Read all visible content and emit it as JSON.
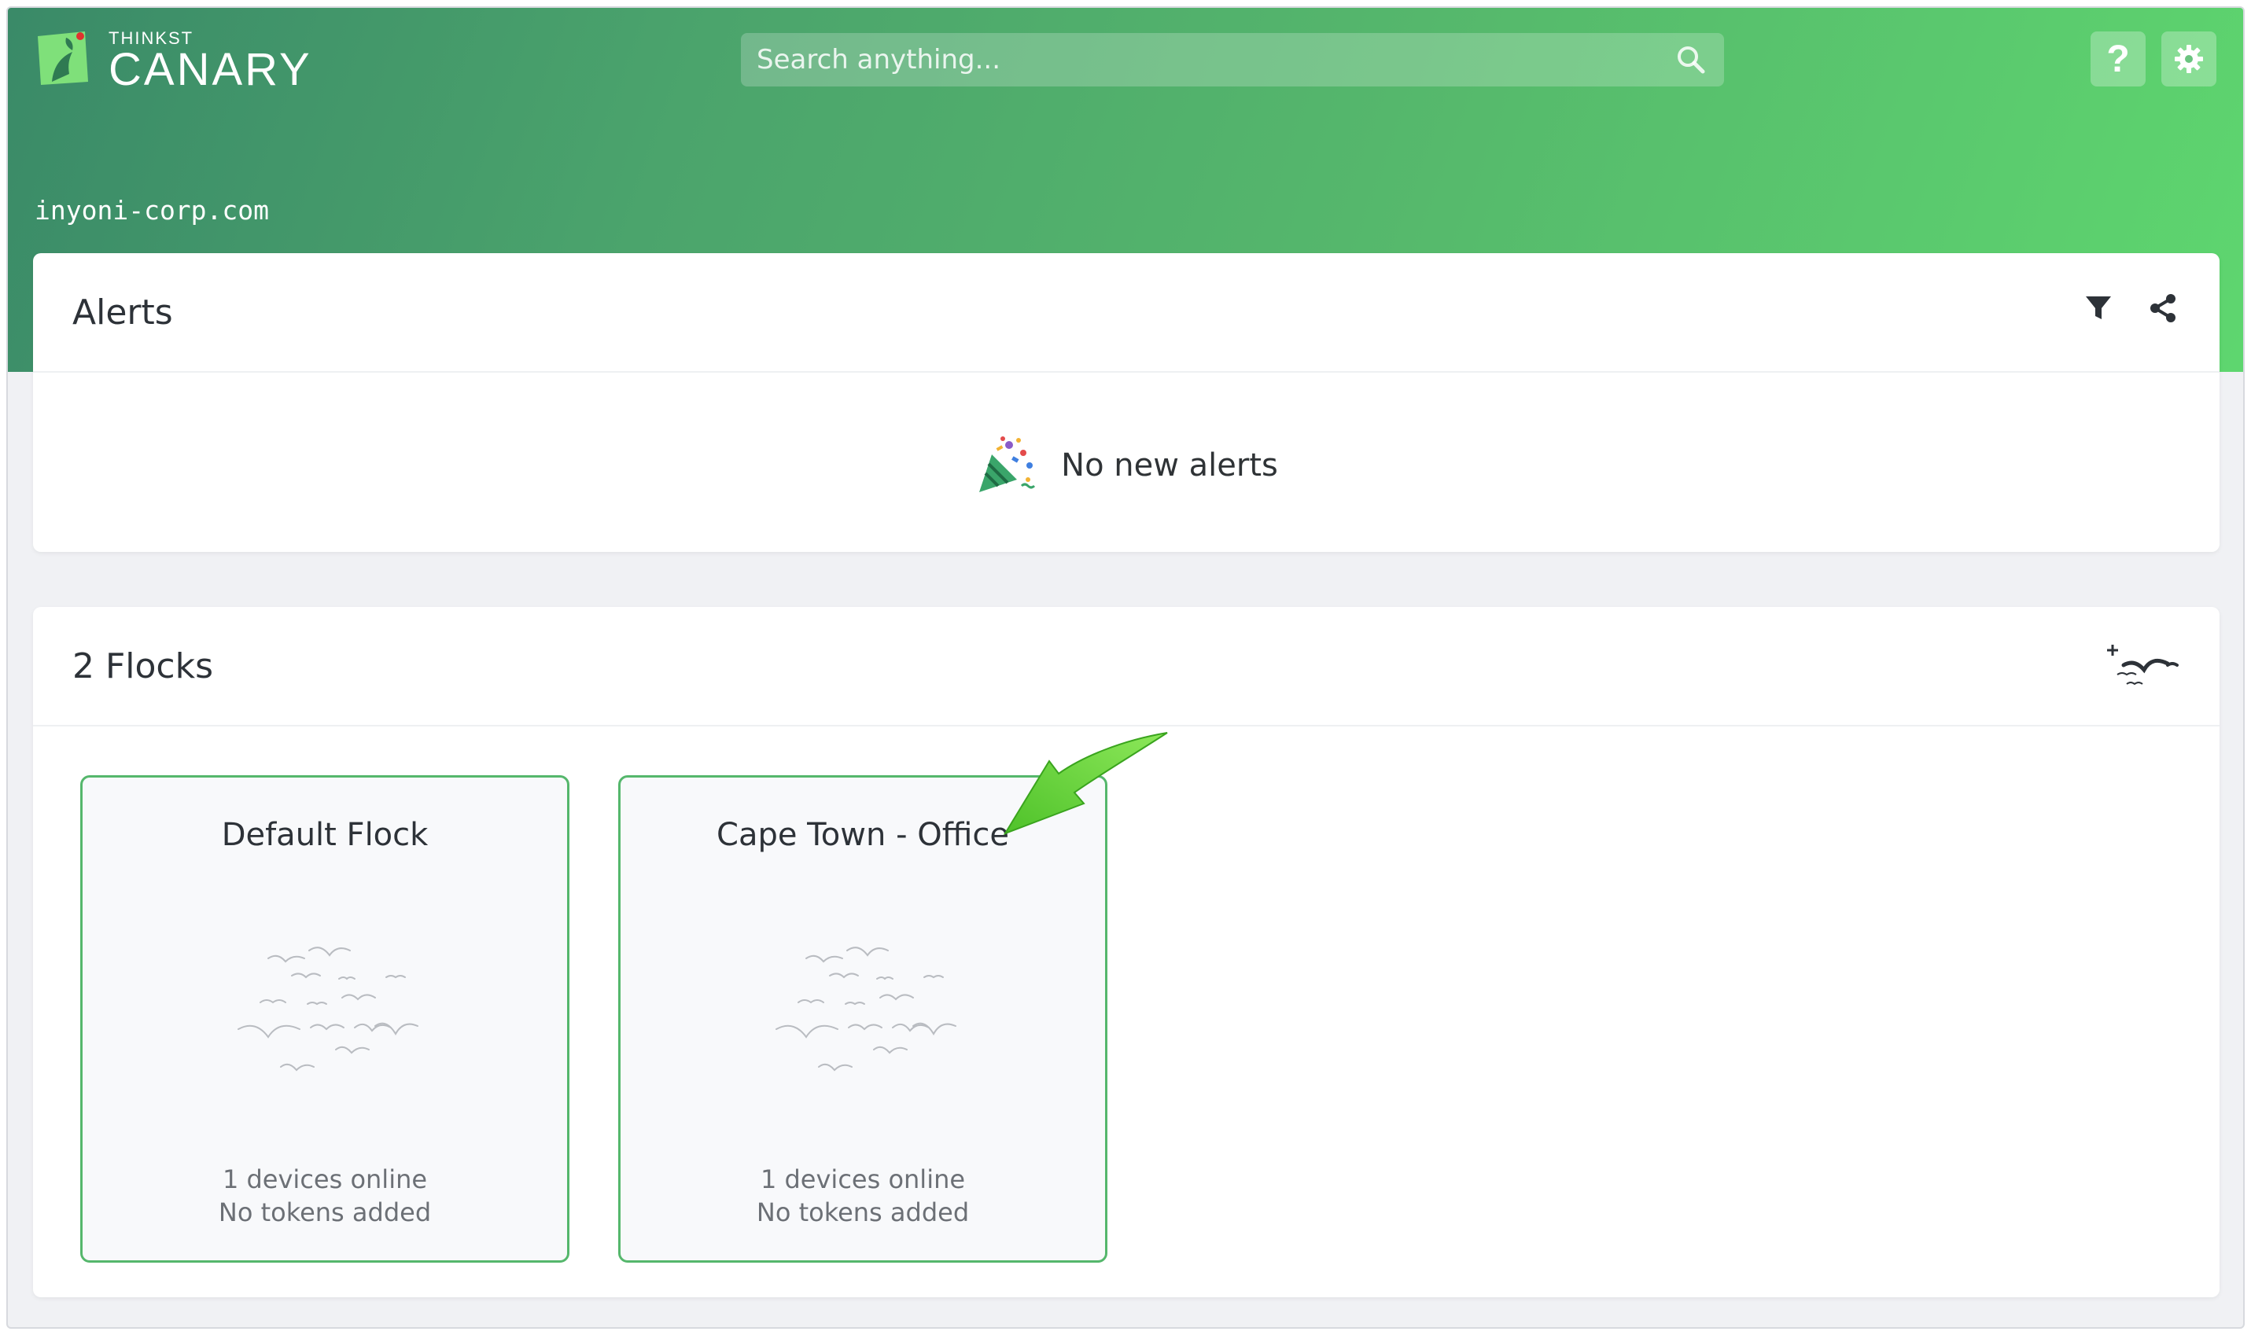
{
  "header": {
    "logo_small": "THINKST",
    "logo_big": "CANARY",
    "search_placeholder": "Search anything...",
    "help_label": "?",
    "domain": "inyoni-corp.com"
  },
  "alerts": {
    "title": "Alerts",
    "empty_message": "No new alerts"
  },
  "flocks": {
    "title": "2 Flocks",
    "items": [
      {
        "name": "Default Flock",
        "devices": "1 devices online",
        "tokens": "No tokens added"
      },
      {
        "name": "Cape Town - Office",
        "devices": "1 devices online",
        "tokens": "No tokens added"
      }
    ]
  },
  "colors": {
    "brand_green": "#55b76c",
    "header_dark": "#3a8a68",
    "header_light": "#5ed66f",
    "annotation_arrow": "#6fdc3c"
  },
  "icons": {
    "logo": "canary-logo-icon",
    "search": "search-icon",
    "settings": "gear-icon",
    "filter": "filter-icon",
    "share": "share-icon",
    "party": "party-popper-icon",
    "add_flock": "add-flock-icon",
    "flock": "birds-flock-icon"
  }
}
